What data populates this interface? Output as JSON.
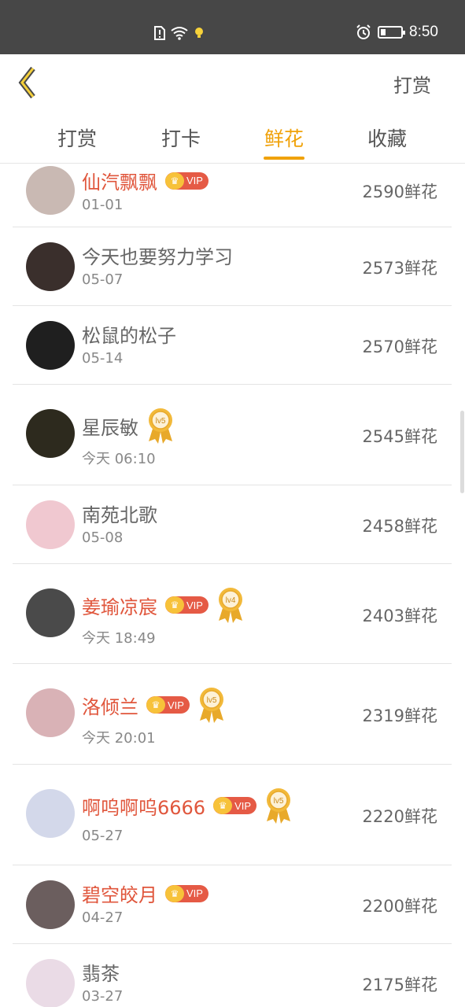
{
  "status_bar": {
    "time": "8:50",
    "battery_level": 0.25,
    "icons": [
      "sim-alert-icon",
      "wifi-icon",
      "bulb-icon",
      "alarm-icon",
      "battery-icon"
    ]
  },
  "header": {
    "back_icon": "chevron-left-icon",
    "right_action": "打赏"
  },
  "tabs": [
    {
      "label": "打赏",
      "active": false
    },
    {
      "label": "打卡",
      "active": false
    },
    {
      "label": "鲜花",
      "active": true
    },
    {
      "label": "收藏",
      "active": false
    }
  ],
  "colors": {
    "accent": "#f0a20a",
    "vip_name": "#e0563c",
    "vip_badge": "#e55a45",
    "status_bar": "#474747"
  },
  "vip_label": "VIP",
  "rows": [
    {
      "name": "仙汽飘飘",
      "vip": true,
      "level": "",
      "date": "01-01",
      "flowers": "2590鲜花",
      "avatar_color": "#c9b9b3"
    },
    {
      "name": "今天也要努力学习",
      "vip": false,
      "level": "",
      "date": "05-07",
      "flowers": "2573鲜花",
      "avatar_color": "#3a2f2c"
    },
    {
      "name": "松鼠的松子",
      "vip": false,
      "level": "",
      "date": "05-14",
      "flowers": "2570鲜花",
      "avatar_color": "#1f1f1f"
    },
    {
      "name": "星辰敏",
      "vip": false,
      "level": "lv5",
      "date": "今天 06:10",
      "flowers": "2545鲜花",
      "avatar_color": "#2d2a1e"
    },
    {
      "name": "南苑北歌",
      "vip": false,
      "level": "",
      "date": "05-08",
      "flowers": "2458鲜花",
      "avatar_color": "#f0c8d0"
    },
    {
      "name": "姜瑜凉宸",
      "vip": true,
      "level": "lv4",
      "date": "今天 18:49",
      "flowers": "2403鲜花",
      "avatar_color": "#4a4a4a"
    },
    {
      "name": "洛倾兰",
      "vip": true,
      "level": "lv5",
      "date": "今天 20:01",
      "flowers": "2319鲜花",
      "avatar_color": "#d9b2b6"
    },
    {
      "name": "啊呜啊呜6666",
      "vip": true,
      "level": "lv5",
      "date": "05-27",
      "flowers": "2220鲜花",
      "avatar_color": "#d3d8ea"
    },
    {
      "name": "碧空皎月",
      "vip": true,
      "level": "",
      "date": "04-27",
      "flowers": "2200鲜花",
      "avatar_color": "#6b5e5e"
    },
    {
      "name": "翡茶",
      "vip": false,
      "level": "",
      "date": "03-27",
      "flowers": "2175鲜花",
      "avatar_color": "#eadbe6"
    }
  ]
}
